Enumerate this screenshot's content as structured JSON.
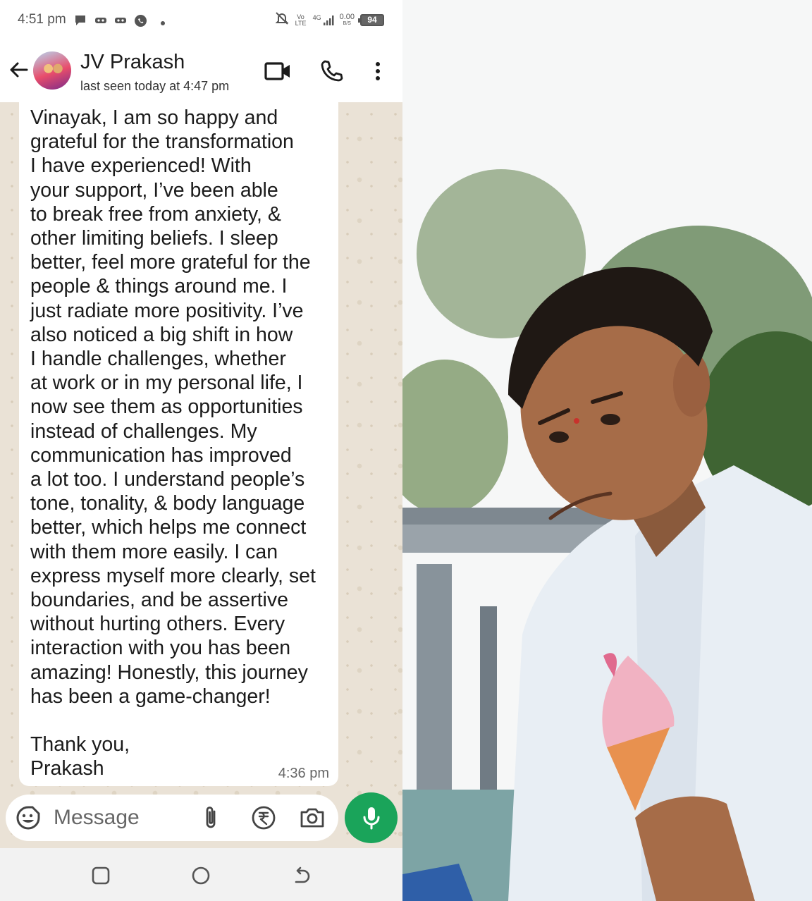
{
  "status_bar": {
    "time": "4:51 pm",
    "network_volte": "Vo LTE",
    "network_4g": "4G",
    "data_speed": "0.00",
    "data_speed_unit": "B/S",
    "battery": "94"
  },
  "header": {
    "contact_name": "JV Prakash",
    "last_seen": "last seen today at 4:47 pm"
  },
  "message": {
    "text": "Vinayak, I am so happy and\ngrateful for the transformation\nI have experienced! With\nyour support, I’ve been able\nto break free from anxiety, &\nother limiting beliefs. I sleep\nbetter, feel more grateful for the\npeople & things around me. I\njust radiate more positivity. I’ve\nalso noticed a big shift in how\nI handle challenges, whether\nat work or in my personal life, I\nnow see them as opportunities\ninstead of challenges. My\ncommunication has improved\na lot too. I understand people’s\ntone, tonality, & body language\nbetter, which helps me connect\nwith them more easily. I can\nexpress myself more clearly, set\nboundaries, and be assertive\nwithout hurting others. Every\ninteraction with you has been\namazing! Honestly, this journey\nhas been a game-changer!\n\nThank you,\nPrakash",
    "time": "4:36 pm"
  },
  "composer": {
    "placeholder": "Message"
  },
  "icons": {
    "back": "arrow-left-icon",
    "video": "video-camera-icon",
    "call": "phone-icon",
    "menu": "more-vertical-icon",
    "emoji": "emoji-icon",
    "attach": "paperclip-icon",
    "pay": "rupee-icon",
    "camera": "camera-icon",
    "mic": "microphone-icon"
  },
  "colors": {
    "mic_button": "#1aa45a",
    "chat_background": "#eae2d6",
    "bubble": "#ffffff"
  }
}
